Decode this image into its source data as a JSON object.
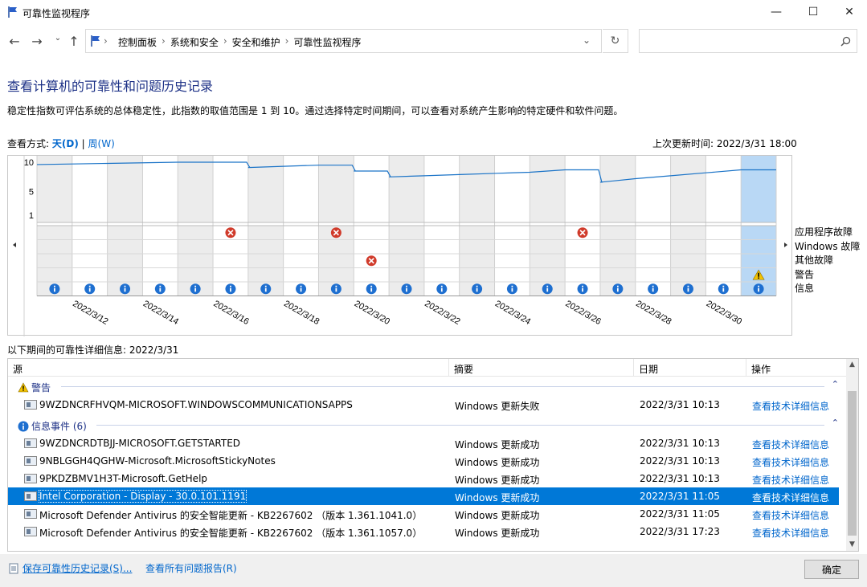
{
  "window": {
    "title": "可靠性监视程序"
  },
  "breadcrumb": [
    "控制面板",
    "系统和安全",
    "安全和维护",
    "可靠性监视程序"
  ],
  "page": {
    "heading": "查看计算机的可靠性和问题历史记录",
    "description": "稳定性指数可评估系统的总体稳定性，此指数的取值范围是 1 到 10。通过选择特定时间期间，可以查看对系统产生影响的特定硬件和软件问题。",
    "view_label": "查看方式:",
    "view_day": "天(D)",
    "view_sep": "|",
    "view_week": "周(W)",
    "last_updated": "上次更新时间: 2022/3/31 18:00",
    "detail_label": "以下期间的可靠性详细信息: 2022/3/31"
  },
  "chart_data": {
    "type": "line",
    "yticks": [
      "10",
      "5",
      "1"
    ],
    "ylim": [
      1,
      10
    ],
    "x_labels": [
      "2022/3/12",
      "2022/3/14",
      "2022/3/16",
      "2022/3/18",
      "2022/3/20",
      "2022/3/22",
      "2022/3/24",
      "2022/3/26",
      "2022/3/28",
      "2022/3/30"
    ],
    "days": [
      "3/11",
      "3/12",
      "3/13",
      "3/14",
      "3/15",
      "3/16",
      "3/17",
      "3/18",
      "3/19",
      "3/20",
      "3/21",
      "3/22",
      "3/23",
      "3/24",
      "3/25",
      "3/26",
      "3/27",
      "3/28",
      "3/29",
      "3/30",
      "3/31"
    ],
    "stability_index": [
      9.6,
      9.7,
      9.8,
      9.9,
      10.0,
      10.0,
      9.1,
      9.3,
      9.5,
      8.5,
      7.5,
      7.7,
      7.9,
      8.1,
      8.3,
      8.7,
      6.6,
      7.2,
      7.7,
      8.2,
      8.7
    ],
    "row_labels": [
      "应用程序故障",
      "Windows 故障",
      "其他故障",
      "警告",
      "信息"
    ],
    "app_failures_days": [
      "3/16",
      "3/19",
      "3/26"
    ],
    "other_failures_days": [
      "3/20"
    ],
    "warning_days": [
      "3/31"
    ],
    "info_days": [
      "3/11",
      "3/12",
      "3/13",
      "3/14",
      "3/15",
      "3/16",
      "3/17",
      "3/18",
      "3/19",
      "3/20",
      "3/21",
      "3/22",
      "3/23",
      "3/24",
      "3/25",
      "3/26",
      "3/27",
      "3/28",
      "3/29",
      "3/30",
      "3/31"
    ],
    "selected_day": "3/31"
  },
  "table": {
    "headers": [
      "源",
      "摘要",
      "日期",
      "操作"
    ],
    "warning_group": "警告",
    "info_group": "信息事件 (6)",
    "rows": [
      {
        "source": "9WZDNCRFHVQM-MICROSOFT.WINDOWSCOMMUNICATIONSAPPS",
        "summary": "Windows 更新失败",
        "date": "2022/3/31 10:13",
        "action": "查看技术详细信息"
      },
      {
        "source": "9WZDNCRDTBJJ-MICROSOFT.GETSTARTED",
        "summary": "Windows 更新成功",
        "date": "2022/3/31 10:13",
        "action": "查看技术详细信息"
      },
      {
        "source": "9NBLGGH4QGHW-Microsoft.MicrosoftStickyNotes",
        "summary": "Windows 更新成功",
        "date": "2022/3/31 10:13",
        "action": "查看技术详细信息"
      },
      {
        "source": "9PKDZBMV1H3T-Microsoft.GetHelp",
        "summary": "Windows 更新成功",
        "date": "2022/3/31 10:13",
        "action": "查看技术详细信息"
      },
      {
        "source": "Intel Corporation - Display - 30.0.101.1191",
        "summary": "Windows 更新成功",
        "date": "2022/3/31 11:05",
        "action": "查看技术详细信息"
      },
      {
        "source": "Microsoft Defender Antivirus 的安全智能更新 - KB2267602  （版本 1.361.1041.0）",
        "summary": "Windows 更新成功",
        "date": "2022/3/31 11:05",
        "action": "查看技术详细信息"
      },
      {
        "source": "Microsoft Defender Antivirus 的安全智能更新 - KB2267602  （版本 1.361.1057.0）",
        "summary": "Windows 更新成功",
        "date": "2022/3/31 17:23",
        "action": "查看技术详细信息"
      }
    ]
  },
  "footer": {
    "save": "保存可靠性历史记录(S)...",
    "view_all": "查看所有问题报告(R)",
    "ok": "确定"
  }
}
